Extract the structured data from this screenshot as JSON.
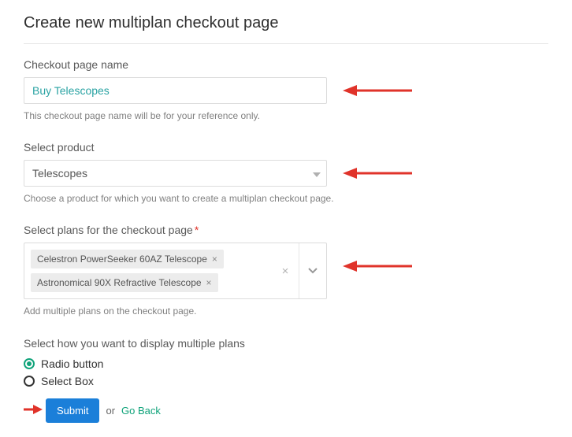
{
  "title": "Create new multiplan checkout page",
  "checkout_name": {
    "label": "Checkout page name",
    "value": "Buy Telescopes",
    "helper": "This checkout page name will be for your reference only."
  },
  "product": {
    "label": "Select product",
    "value": "Telescopes",
    "helper": "Choose a product for which you want to create a multiplan checkout page."
  },
  "plans": {
    "label": "Select plans for the checkout page",
    "required": "*",
    "selected": [
      "Celestron PowerSeeker 60AZ Telescope",
      "Astronomical 90X Refractive Telescope"
    ],
    "helper": "Add multiple plans on the checkout page."
  },
  "display": {
    "label": "Select how you want to display multiple plans",
    "options": [
      "Radio button",
      "Select Box"
    ],
    "selected": "Radio button"
  },
  "buttons": {
    "submit": "Submit",
    "or": "or",
    "go_back": "Go Back"
  }
}
